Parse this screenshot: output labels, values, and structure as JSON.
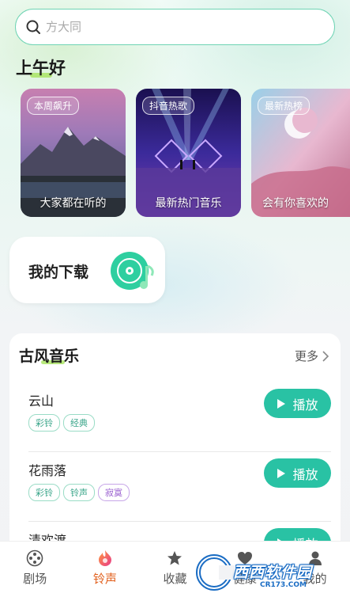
{
  "search": {
    "placeholder": "方大同",
    "icon": "search-icon"
  },
  "greeting": "上午好",
  "cards": [
    {
      "tag": "本周飙升",
      "caption": "大家都在听的"
    },
    {
      "tag": "抖音热歌",
      "caption": "最新热门音乐"
    },
    {
      "tag": "最新热榜",
      "caption": "会有你喜欢的"
    }
  ],
  "download": {
    "label": "我的下载",
    "icon": "music-disc-icon"
  },
  "section": {
    "title": "古风音乐",
    "more": "更多",
    "items": [
      {
        "name": "云山",
        "tags": [
          "彩铃",
          "经典"
        ],
        "play": "播放"
      },
      {
        "name": "花雨落",
        "tags": [
          "彩铃",
          "铃声",
          "寂寞"
        ],
        "play": "播放"
      },
      {
        "name": "清欢渡",
        "tags": [],
        "play": "播放"
      }
    ]
  },
  "nav": [
    {
      "label": "剧场",
      "icon": "film-reel-icon",
      "active": false
    },
    {
      "label": "铃声",
      "icon": "flame-icon",
      "active": true
    },
    {
      "label": "收藏",
      "icon": "star-icon",
      "active": false
    },
    {
      "label": "健康",
      "icon": "heart-icon",
      "active": false
    },
    {
      "label": "我的",
      "icon": "person-icon",
      "active": false
    }
  ],
  "watermark": {
    "text": "西西软件园",
    "sub": "CR173.COM"
  },
  "colors": {
    "accent": "#29c2a4",
    "nav_active": "#e2611e",
    "search_border": "#6fd4b4"
  }
}
